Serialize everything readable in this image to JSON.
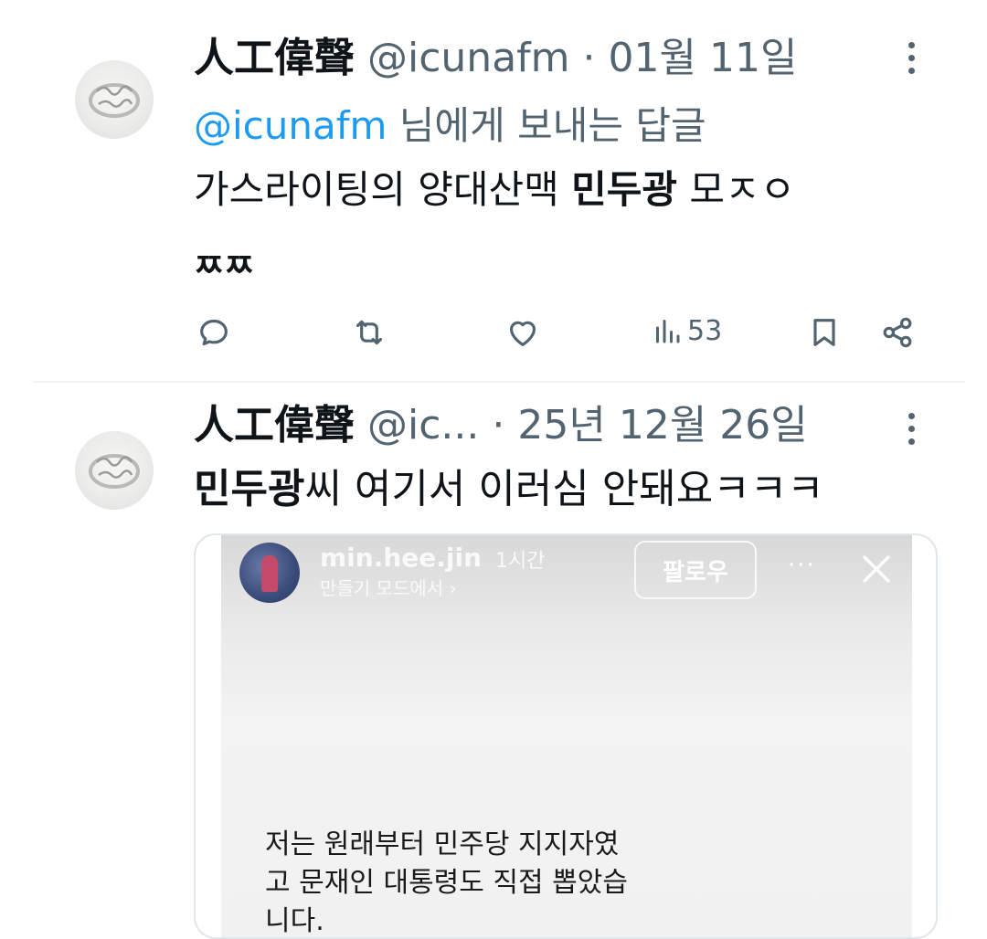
{
  "tweets": [
    {
      "name": "人工偉聲",
      "handle": "@icunafm",
      "separator": "·",
      "date": "01월 11일",
      "reply_mention": "@icunafm",
      "reply_suffix": "님에게 보내는 답글",
      "body_prefix": "가스라이팅의 양대산맥 ",
      "body_bold": "민두광",
      "body_suffix": " 모ㅈㅇ",
      "body_line2": "ㅉㅉ",
      "stats": {
        "views": "53"
      }
    },
    {
      "name": "人工偉聲",
      "handle": "@ic...",
      "separator": "·",
      "date": "25년 12월 26일",
      "body_bold": "민두광",
      "body_suffix": "씨 여기서 이러심 안돼요ㅋㅋㅋ",
      "media": {
        "username": "min.hee.jin",
        "time": "1시간",
        "subtitle": "만들기 모드에서 ›",
        "follow_label": "팔로우",
        "more": "···",
        "text_lines": [
          "저는 원래부터 민주당 지지자였",
          "고 문재인 대통령도 직접 뽑았습",
          "니다."
        ]
      }
    }
  ],
  "colors": {
    "text": "#0f1419",
    "muted": "#536471",
    "link": "#1d9bf0",
    "divider": "#eff3f4"
  }
}
